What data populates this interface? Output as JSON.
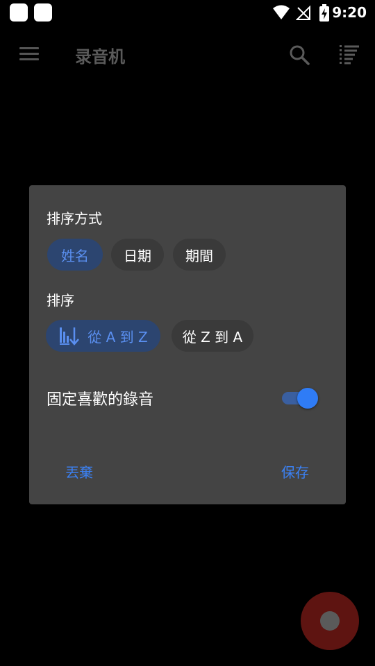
{
  "status_bar": {
    "time": "9:20"
  },
  "app_bar": {
    "title": "录音机"
  },
  "dialog": {
    "sort_by_label": "排序方式",
    "sort_by_options": [
      {
        "label": "姓名",
        "selected": true
      },
      {
        "label": "日期",
        "selected": false
      },
      {
        "label": "期間",
        "selected": false
      }
    ],
    "order_label": "排序",
    "order_options": [
      {
        "label": "從 A 到 Z",
        "selected": true
      },
      {
        "label": "從 Z 到 A",
        "selected": false
      }
    ],
    "pin_favorites_label": "固定喜歡的錄音",
    "pin_favorites_on": true,
    "discard_label": "丟棄",
    "save_label": "保存"
  },
  "colors": {
    "accent": "#2f7cf6",
    "selected_chip_bg": "#2c4570",
    "dialog_bg": "#444444",
    "fab": "#5e1411"
  }
}
